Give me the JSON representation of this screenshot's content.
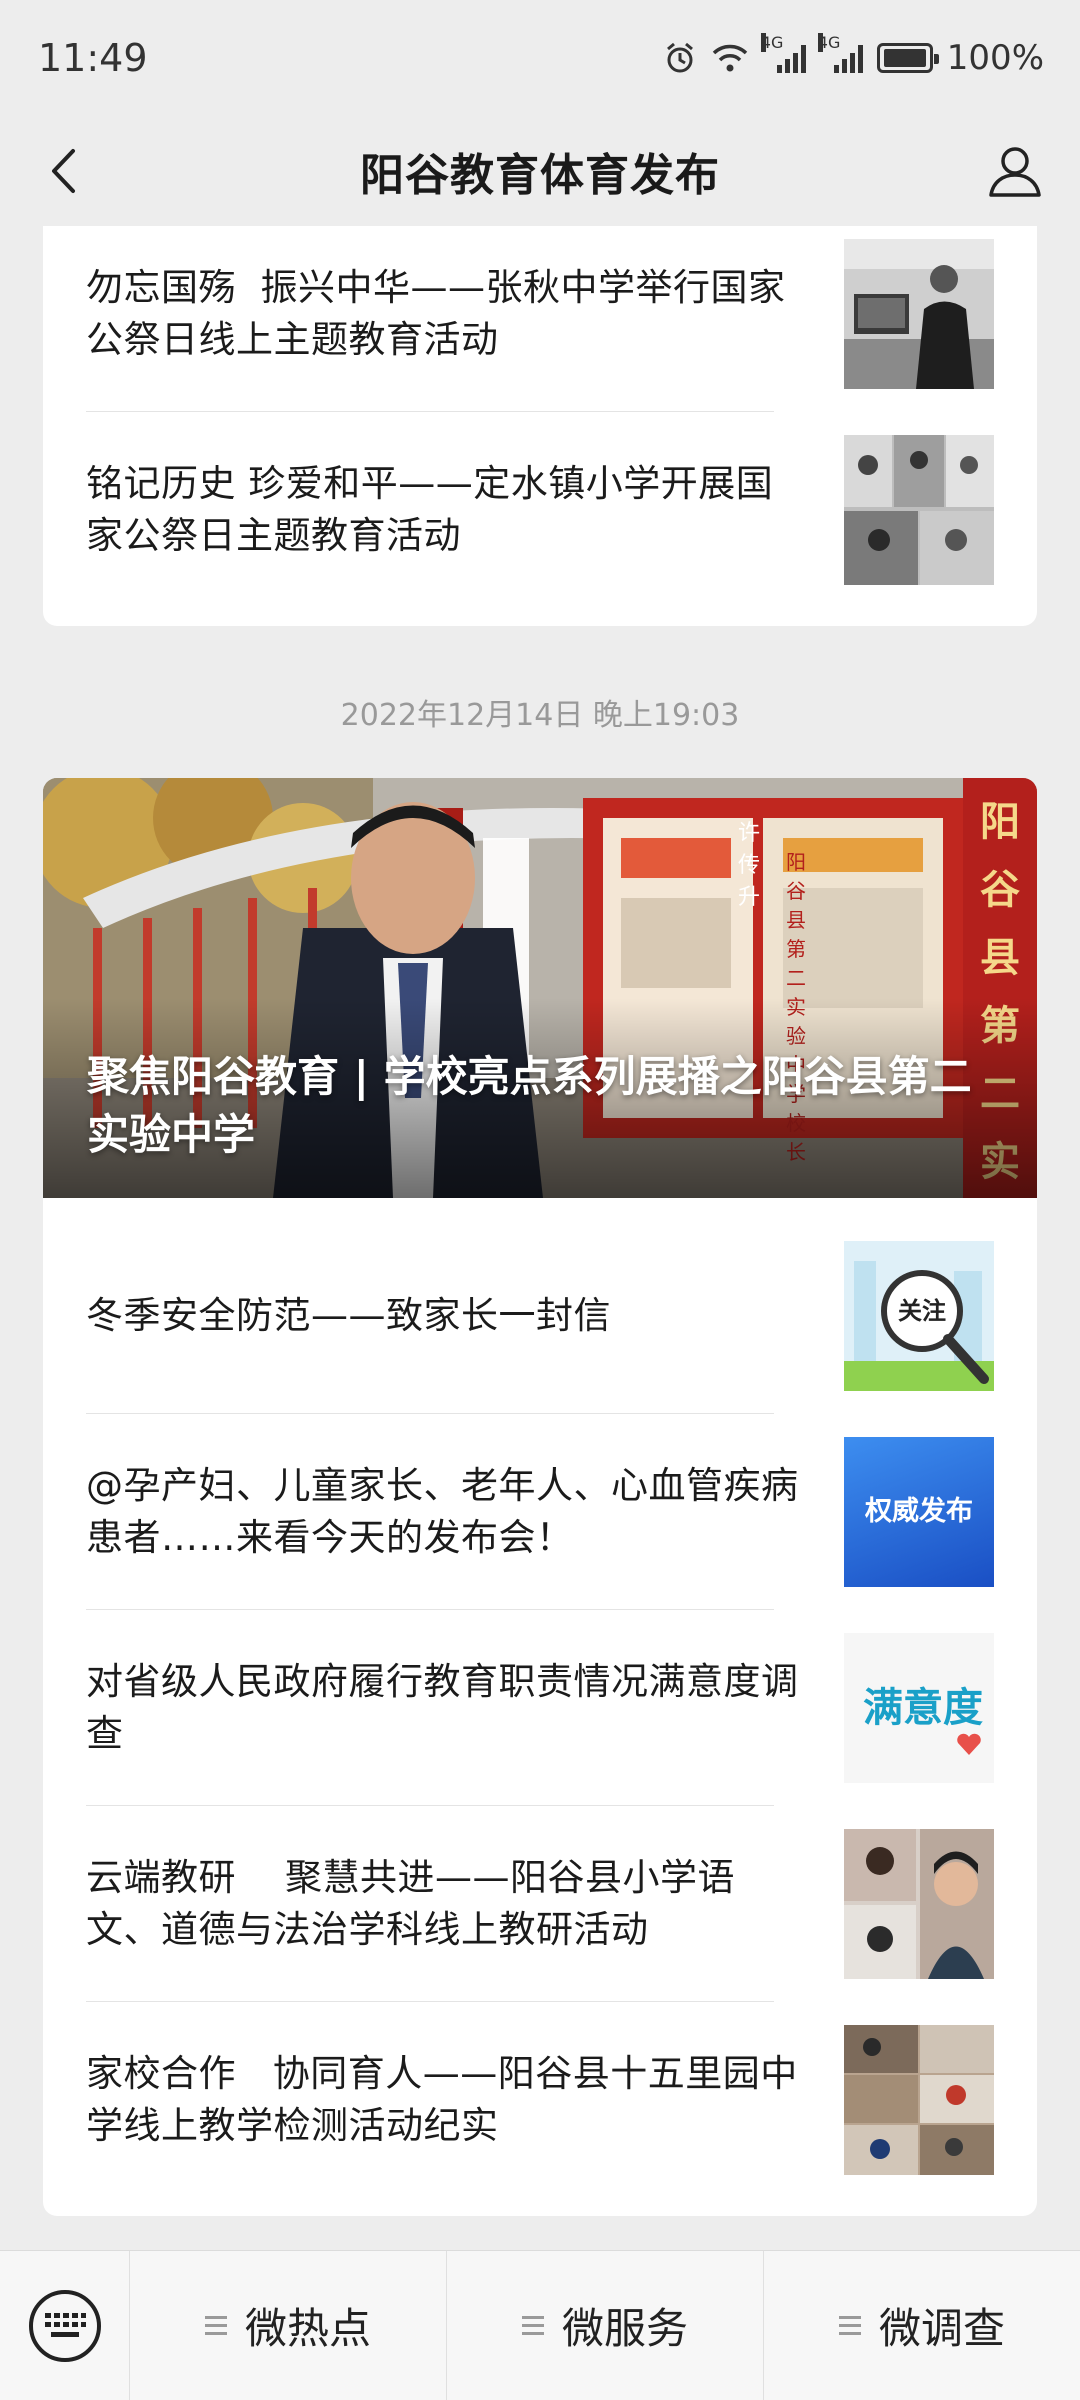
{
  "status": {
    "time": "11:49",
    "network1": "4G",
    "network2": "4G",
    "battery": "100%"
  },
  "nav": {
    "title": "阳谷教育体育发布"
  },
  "card1": {
    "items": [
      {
        "title": "勿忘国殇  振兴中华——张秋中学举行国家公祭日线上主题教育活动"
      },
      {
        "title": "铭记历史 珍爱和平——定水镇小学开展国家公祭日主题教育活动"
      }
    ]
  },
  "timestamp": "2022年12月14日 晚上19:03",
  "card2": {
    "hero": {
      "title": "聚焦阳谷教育 | 学校亮点系列展播之阳谷县第二实验中学",
      "banner_vertical": "阳谷县第二实验",
      "name_plate": "许传升",
      "role_plate": "阳谷县第二实验中学校长"
    },
    "items": [
      {
        "title": "冬季安全防范——致家长一封信",
        "thumb_label": "关注"
      },
      {
        "title": "@孕产妇、儿童家长、老年人、心血管疾病患者……来看今天的发布会！",
        "thumb_label": "权威发布"
      },
      {
        "title": "对省级人民政府履行教育职责情况满意度调查",
        "thumb_label": "满意度"
      },
      {
        "title": "云端教研    聚慧共进——阳谷县小学语文、道德与法治学科线上教研活动"
      },
      {
        "title": "家校合作   协同育人——阳谷县十五里园中学线上教学检测活动纪实"
      }
    ]
  },
  "tabbar": {
    "tabs": [
      "微热点",
      "微服务",
      "微调查"
    ]
  },
  "colors": {
    "accent_blue": "#1f5fcf",
    "hero_red": "#b3201c"
  }
}
